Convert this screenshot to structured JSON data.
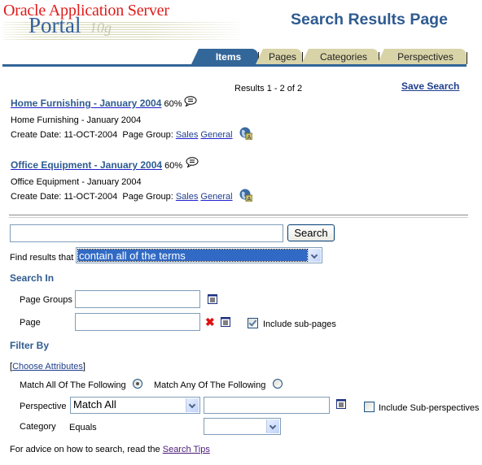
{
  "header": {
    "logo_line1": "Oracle Application Server",
    "logo_line2": "Portal",
    "page_title": "Search Results Page"
  },
  "tabs": [
    {
      "label": "Items",
      "active": true
    },
    {
      "label": "Pages",
      "active": false
    },
    {
      "label": "Categories",
      "active": false
    },
    {
      "label": "Perspectives",
      "active": false
    }
  ],
  "results": {
    "count_text": "Results 1 - 2 of 2",
    "save_search_label": "Save Search",
    "items": [
      {
        "title": "Home Furnishing - January 2004",
        "score": "60%",
        "description": "Home Furnishing - January 2004",
        "create_date_label": "Create Date:",
        "create_date": "11-OCT-2004",
        "page_group_label": "Page Group:",
        "page_group_links": [
          "Sales",
          "General"
        ]
      },
      {
        "title": "Office Equipment - January 2004",
        "score": "60%",
        "description": "Office Equipment - January 2004",
        "create_date_label": "Create Date:",
        "create_date": "11-OCT-2004",
        "page_group_label": "Page Group:",
        "page_group_links": [
          "Sales",
          "General"
        ]
      }
    ]
  },
  "search_form": {
    "query_value": "",
    "search_button_label": "Search",
    "find_results_label": "Find results that",
    "find_results_selected": "contain all of the terms",
    "search_in_heading": "Search In",
    "page_groups_label": "Page Groups",
    "page_groups_value": "",
    "page_label": "Page",
    "page_value": "",
    "include_subpages_label": "Include sub-pages",
    "include_subpages_checked": true,
    "filter_by_heading": "Filter By",
    "choose_attributes_open": "[",
    "choose_attributes_label": "Choose Attributes",
    "choose_attributes_close": "]",
    "match_all_label": "Match All Of The Following",
    "match_all_selected": true,
    "match_any_label": "Match Any Of The Following",
    "match_any_selected": false,
    "perspective_label": "Perspective",
    "perspective_operator_selected": "Match All",
    "perspective_value": "",
    "include_subperspectives_label": "Include Sub-perspectives",
    "include_subperspectives_checked": false,
    "category_label": "Category",
    "category_operator": "Equals",
    "category_selected": "",
    "advice_text": "For advice on how to search, read the",
    "search_tips_label": "Search Tips"
  },
  "icons": {
    "comment": "speech-bubble-icon",
    "globe": "globe-page-icon",
    "list": "list-picker-icon",
    "clear": "red-x-icon"
  },
  "colors": {
    "brand_red": "#e01b1b",
    "brand_blue": "#336699",
    "tab_inactive": "#d9d4a8",
    "heading_blue": "#2e5b90"
  }
}
